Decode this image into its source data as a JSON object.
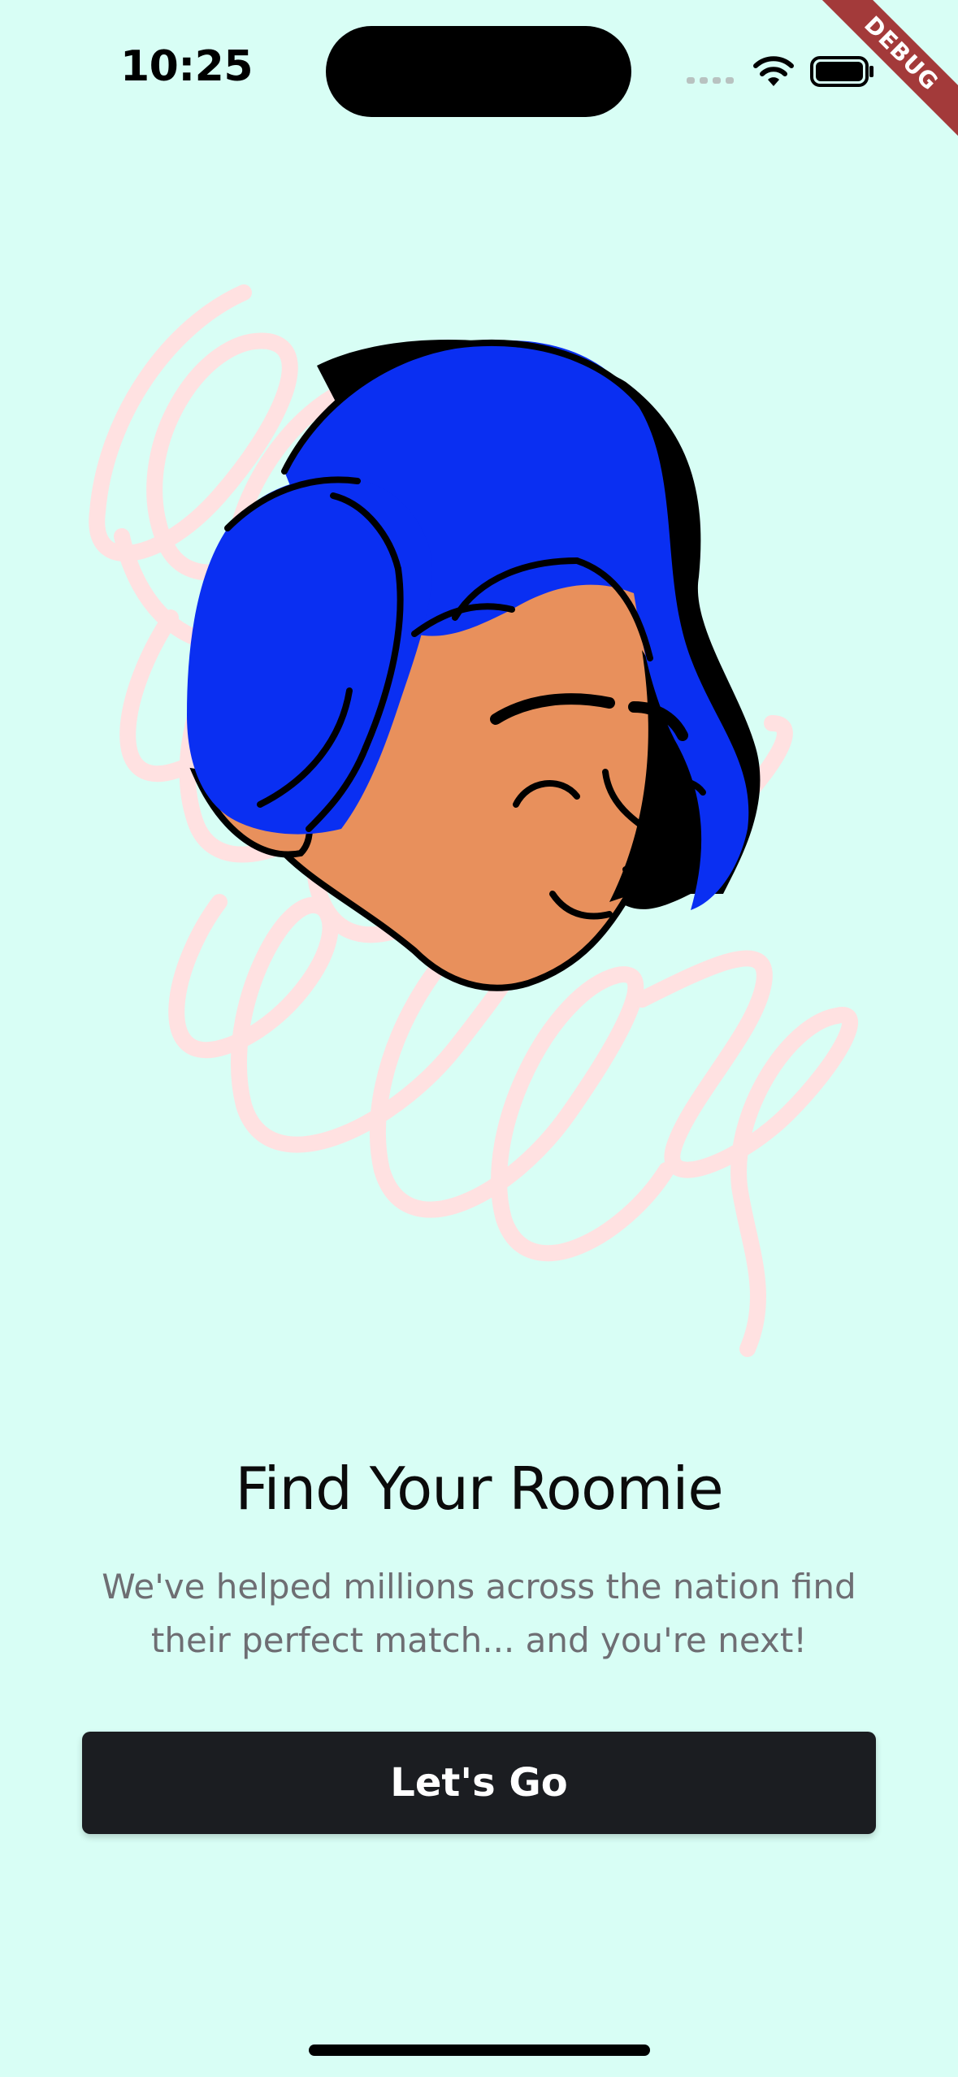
{
  "status_bar": {
    "time": "10:25",
    "signal_icon": "signal-dots-icon",
    "wifi_icon": "wifi-icon",
    "battery_icon": "battery-icon"
  },
  "debug_banner": {
    "label": "DEBUG",
    "color": "#a33a3a"
  },
  "illustration": {
    "icon": "smiling-girl-avatar-icon",
    "scribble_color": "#ffe1e1",
    "hair_color": "#0a2ff2",
    "skin_color": "#e8905c"
  },
  "onboarding": {
    "title": "Find Your Roomie",
    "subtitle": "We've helped millions across the nation find their perfect match... and you're next!",
    "button_label": "Let's Go"
  },
  "colors": {
    "background": "#d8fef5",
    "button_background": "#1b1d21",
    "button_text": "#ffffff",
    "subtitle_text": "#6e6e73"
  }
}
